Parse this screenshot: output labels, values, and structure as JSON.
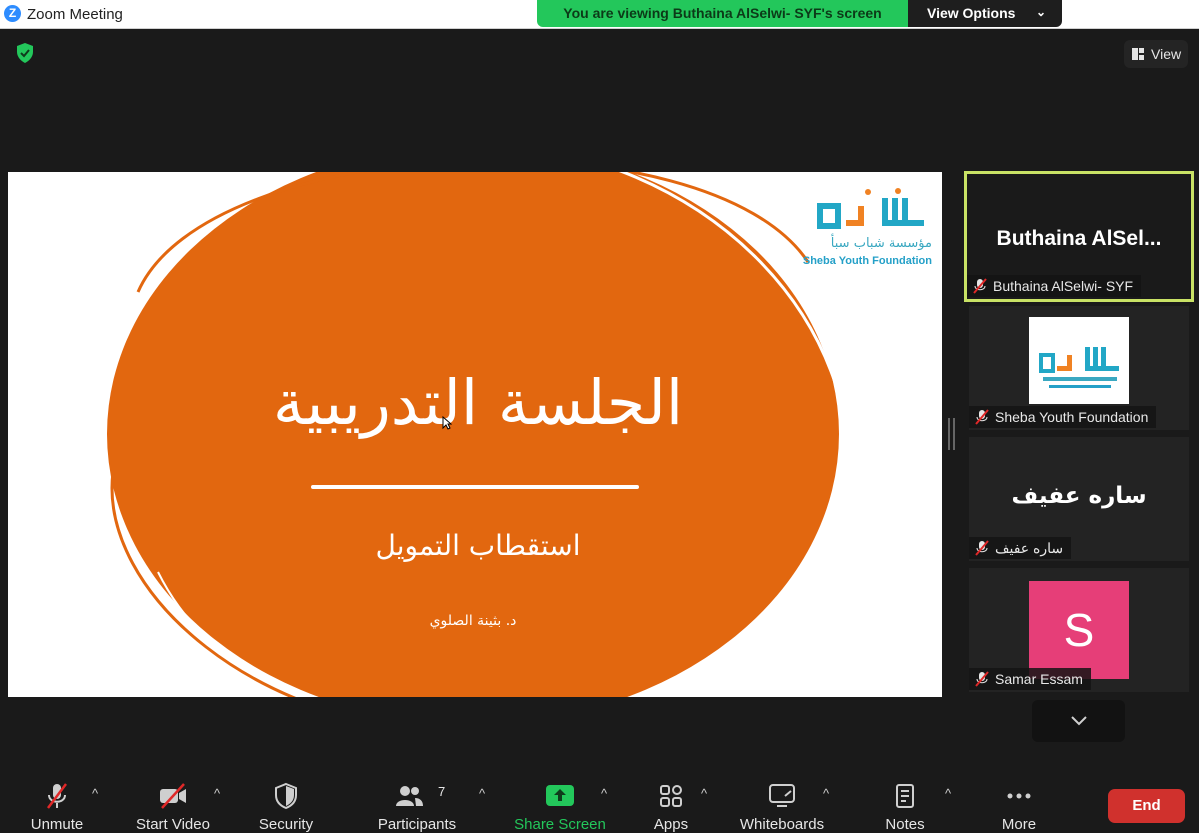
{
  "window": {
    "app_icon_letter": "Z",
    "title": "Zoom Meeting"
  },
  "banner": {
    "text": "You are viewing Buthaina AlSelwi- SYF's screen",
    "view_options_label": "View Options"
  },
  "top_right": {
    "view_label": "View"
  },
  "slide": {
    "title": "الجلسة التدريبية",
    "subtitle": "استقطاب التمويل",
    "author": "د. بثينة الصلوي",
    "logo_arabic": "مؤسسة شباب سبأ",
    "logo_english": "Sheba Youth Foundation",
    "colors": {
      "circle": "#e2670f",
      "logo_teal": "#22a7c6",
      "logo_orange": "#f08223"
    }
  },
  "participants": [
    {
      "display": "Buthaina  AlSel...",
      "name": "Buthaina AlSelwi- SYF",
      "muted": true,
      "active_speaker": true
    },
    {
      "display": "",
      "name": "Sheba Youth Foundation",
      "muted": true,
      "image": "sheba-logo"
    },
    {
      "display": "ساره عفيف",
      "name": "ساره عفيف",
      "muted": true
    },
    {
      "display": "S",
      "name": "Samar Essam",
      "muted": true,
      "avatar_color": "#e63e78"
    }
  ],
  "toolbar": {
    "unmute": "Unmute",
    "start_video": "Start Video",
    "security": "Security",
    "participants": "Participants",
    "participants_count": "7",
    "share_screen": "Share Screen",
    "apps": "Apps",
    "whiteboards": "Whiteboards",
    "notes": "Notes",
    "more": "More",
    "end": "End"
  },
  "colors": {
    "share_green": "#23c75b",
    "active_border": "#c9e265",
    "end_red": "#d0312d"
  }
}
